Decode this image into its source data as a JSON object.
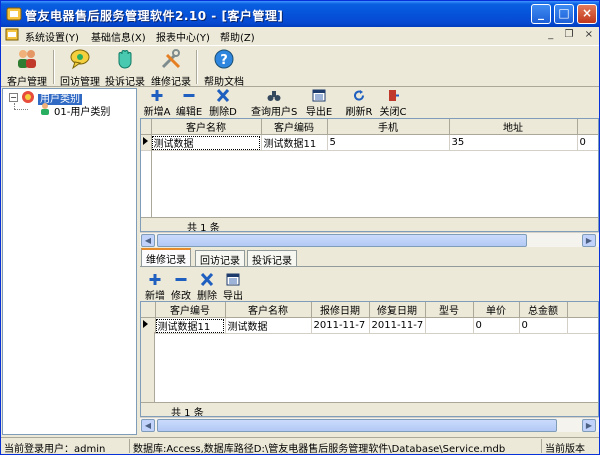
{
  "window": {
    "title": "管友电器售后服务管理软件2.10 - [客户管理]",
    "buttons": {
      "minimize": "_",
      "maximize": "□",
      "close": "×"
    }
  },
  "menu": {
    "items": [
      "系统设置(Y)",
      "基础信息(X)",
      "报表中心(Y)",
      "帮助(Z)"
    ],
    "mdi": {
      "minimize": "_",
      "restore": "❐",
      "close": "×"
    }
  },
  "toolbar": {
    "buttons": [
      {
        "label": "客户管理",
        "icon": "users-icon"
      },
      {
        "label": "回访管理",
        "icon": "chat-icon"
      },
      {
        "label": "投诉记录",
        "icon": "hand-icon"
      },
      {
        "label": "维修记录",
        "icon": "tools-icon"
      },
      {
        "label": "帮助文档",
        "icon": "help-icon"
      }
    ]
  },
  "tree": {
    "root": {
      "label": "用户类别",
      "expander": "−"
    },
    "children": [
      {
        "label": "01-用户类别"
      }
    ]
  },
  "customer_toolbar": {
    "buttons": [
      {
        "label": "新增A",
        "icon": "plus-icon"
      },
      {
        "label": "编辑E",
        "icon": "minus-icon"
      },
      {
        "label": "删除D",
        "icon": "delete-icon"
      },
      {
        "label": "查询用户S",
        "icon": "binoculars-icon"
      },
      {
        "label": "导出E",
        "icon": "export-icon"
      },
      {
        "label": "刷新R",
        "icon": "refresh-icon"
      },
      {
        "label": "关闭C",
        "icon": "exit-icon"
      }
    ]
  },
  "customer_grid": {
    "columns": [
      "客户名称",
      "客户编码",
      "手机",
      "地址",
      ""
    ],
    "rows": [
      [
        "测试数据",
        "测试数据11",
        "5",
        "35",
        "0"
      ]
    ],
    "footer": "共 1 条"
  },
  "tabs": [
    "维修记录",
    "回访记录",
    "投诉记录"
  ],
  "repair_toolbar": {
    "buttons": [
      {
        "label": "新增",
        "icon": "plus-icon"
      },
      {
        "label": "修改",
        "icon": "minus-icon"
      },
      {
        "label": "删除",
        "icon": "delete-icon"
      },
      {
        "label": "导出",
        "icon": "export-icon"
      }
    ]
  },
  "repair_grid": {
    "columns": [
      "客户编号",
      "客户名称",
      "报修日期",
      "修复日期",
      "型号",
      "单价",
      "总金额",
      ""
    ],
    "rows": [
      [
        "测试数据11",
        "测试数据",
        "2011-11-7",
        "2011-11-7",
        "",
        "0",
        "0",
        ""
      ]
    ],
    "footer": "共 1 条"
  },
  "statusbar": {
    "user": "当前登录用户：admin",
    "database": "数据库:Access,数据库路径D:\\管友电器售后服务管理软件\\Database\\Service.mdb",
    "version": "当前版本"
  },
  "colors": {
    "title_bar": "#0553da",
    "selection": "#316ac5",
    "active_tab": "#e68b2c"
  }
}
